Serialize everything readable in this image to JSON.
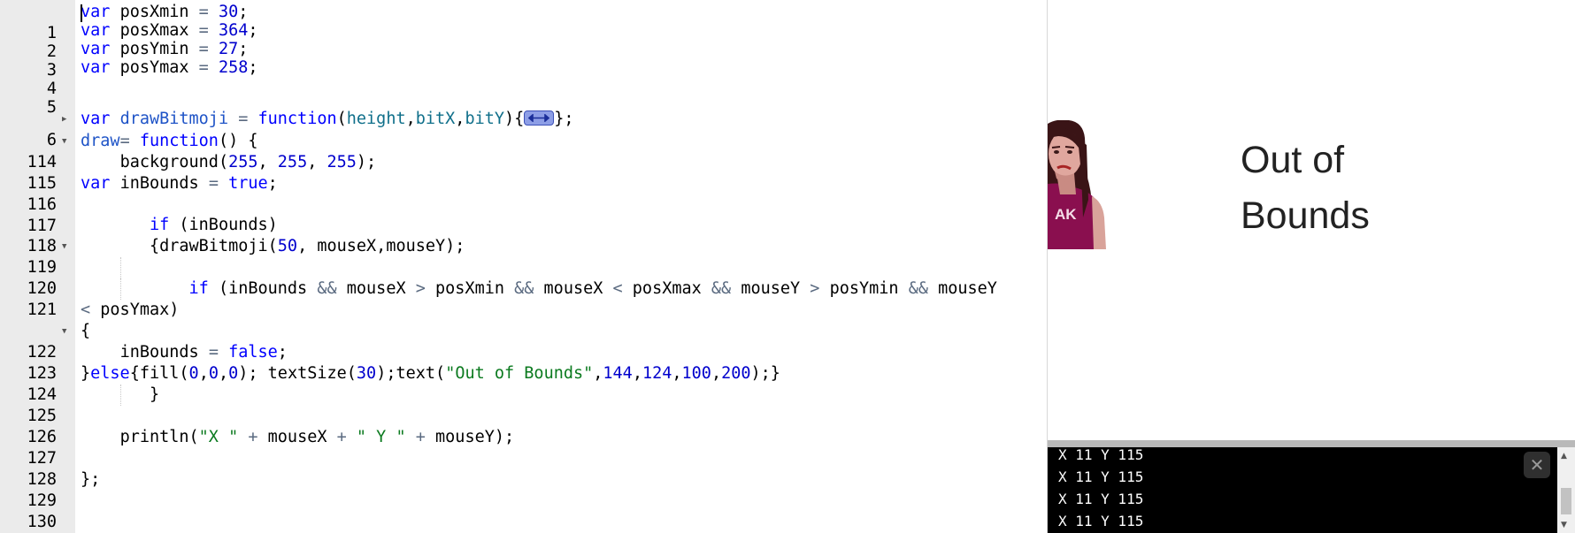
{
  "editor": {
    "lines": [
      {
        "n": "1"
      },
      {
        "n": "2"
      },
      {
        "n": "3"
      },
      {
        "n": "4"
      },
      {
        "n": "5"
      },
      {
        "n": "6"
      },
      {
        "n": "114"
      },
      {
        "n": "115"
      },
      {
        "n": "116"
      },
      {
        "n": "117"
      },
      {
        "n": "118"
      },
      {
        "n": "119"
      },
      {
        "n": "120"
      },
      {
        "n": "121"
      },
      {
        "n": ""
      },
      {
        "n": "122"
      },
      {
        "n": "123"
      },
      {
        "n": "124"
      },
      {
        "n": "125"
      },
      {
        "n": "126"
      },
      {
        "n": "127"
      },
      {
        "n": "128"
      },
      {
        "n": "129"
      },
      {
        "n": "130"
      }
    ],
    "code": {
      "var": "var",
      "function": "function",
      "true": "true",
      "false": "false",
      "if": "if",
      "else": "else",
      "posXmin": "posXmin",
      "posXmax": "posXmax",
      "posYmin": "posYmin",
      "posYmax": "posYmax",
      "v30": "30",
      "v364": "364",
      "v27": "27",
      "v258": "258",
      "drawBitmoji": "drawBitmoji",
      "height": "height",
      "bitX": "bitX",
      "bitY": "bitY",
      "draw": "draw",
      "background": "background",
      "v255": "255",
      "inBounds": "inBounds",
      "mouseX": "mouseX",
      "mouseY": "mouseY",
      "v50": "50",
      "fill": "fill",
      "v0": "0",
      "textSize": "textSize",
      "text": "text",
      "outStr": "\"Out of Bounds\"",
      "v144": "144",
      "v124": "124",
      "v100": "100",
      "v200": "200",
      "println": "println",
      "strX": "\"X \"",
      "strY": "\" Y \""
    }
  },
  "output": {
    "canvas_text_line1": "Out of",
    "canvas_text_line2": "Bounds",
    "bitmoji_initials": "AK"
  },
  "console": {
    "lines": [
      "X 11 Y 115",
      "X 11 Y 115",
      "X 11 Y 115",
      "X 11 Y 115"
    ],
    "close_label": "✕"
  },
  "colors": {
    "keyword": "#0000ff",
    "number": "#0000cd",
    "string": "#0b7a1f",
    "gutter": "#ebebeb",
    "console_bg": "#000000",
    "bitmoji_shirt": "#8a0f4f",
    "bitmoji_hair": "#3a1416"
  }
}
